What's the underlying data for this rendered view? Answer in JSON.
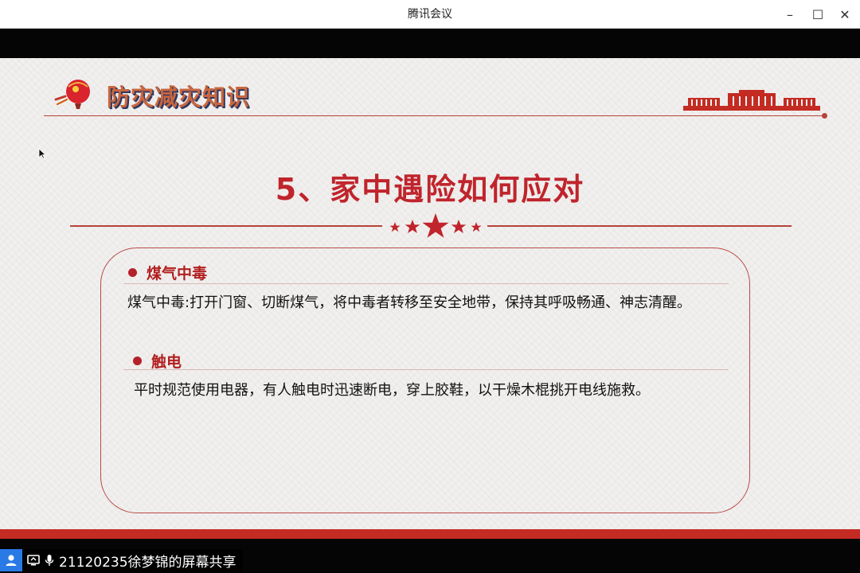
{
  "window": {
    "title": "腾讯会议",
    "controls": {
      "minimize": "–",
      "maximize": "☐",
      "close": "✕"
    }
  },
  "slide": {
    "header_title": "防灾减灾知识",
    "main_title": "5、家中遇险如何应对",
    "sections": [
      {
        "heading": "煤气中毒",
        "text": "煤气中毒:打开门窗、切断煤气，将中毒者转移至安全地带，保持其呼吸畅通、神志清醒。"
      },
      {
        "heading": "触电",
        "text": "平时规范使用电器，有人触电时迅速断电，穿上胶鞋，以干燥木棍挑开电线施救。"
      }
    ],
    "colors": {
      "accent_red": "#c0242c",
      "line_red": "#b8423a",
      "header_orange": "#c8663f"
    }
  },
  "status": {
    "share_label": "21120235徐梦锦的屏幕共享",
    "icons": [
      "user-icon",
      "screen-share-icon",
      "microphone-icon"
    ]
  }
}
